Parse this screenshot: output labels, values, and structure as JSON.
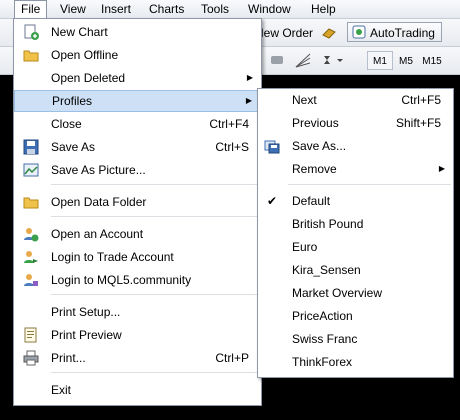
{
  "menubar": {
    "items": [
      "File",
      "View",
      "Insert",
      "Charts",
      "Tools",
      "Window",
      "Help"
    ]
  },
  "toolbar": {
    "new_order": "New Order",
    "autotrading": "AutoTrading",
    "timeframes": [
      "M1",
      "M5",
      "M15"
    ]
  },
  "file_menu": {
    "new_chart": "New Chart",
    "open_offline": "Open Offline",
    "open_deleted": "Open Deleted",
    "profiles": "Profiles",
    "close": "Close",
    "close_sc": "Ctrl+F4",
    "save_as": "Save As",
    "save_as_sc": "Ctrl+S",
    "save_as_picture": "Save As Picture...",
    "open_data_folder": "Open Data Folder",
    "open_account": "Open an Account",
    "login_trade": "Login to Trade Account",
    "login_mql5": "Login to MQL5.community",
    "print_setup": "Print Setup...",
    "print_preview": "Print Preview",
    "print": "Print...",
    "print_sc": "Ctrl+P",
    "exit": "Exit"
  },
  "profiles_menu": {
    "next": "Next",
    "next_sc": "Ctrl+F5",
    "previous": "Previous",
    "previous_sc": "Shift+F5",
    "save_as": "Save As...",
    "remove": "Remove",
    "profiles": [
      "Default",
      "British Pound",
      "Euro",
      "Kira_Sensen",
      "Market Overview",
      "PriceAction",
      "Swiss Franc",
      "ThinkForex"
    ],
    "checked": "Default"
  },
  "colors": {
    "highlight": "#cde0f5",
    "menu_border": "#8e98a8",
    "chart_bg": "#000000"
  }
}
